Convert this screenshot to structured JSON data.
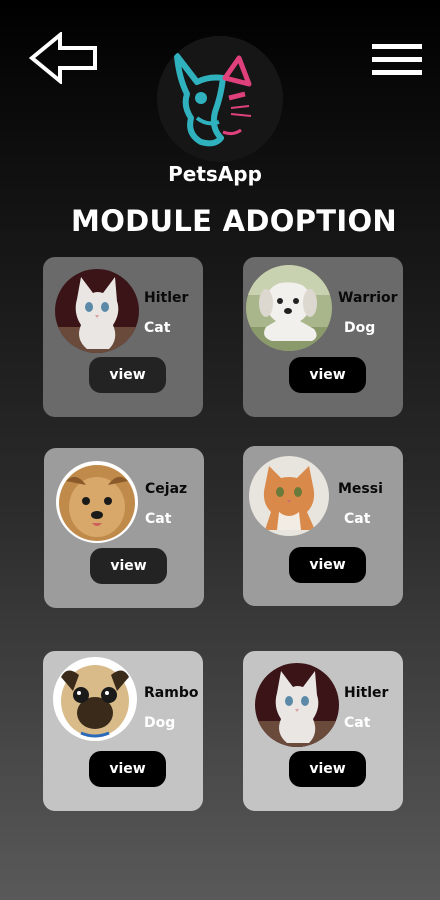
{
  "header": {
    "app_name": "PetsApp",
    "back_icon": "arrow-left-icon",
    "menu_icon": "hamburger-menu-icon",
    "logo": "dog-face-neon-logo"
  },
  "title": "MODULE ADOPTION",
  "colors": {
    "card_row1": "#6a6a6a",
    "card_row2": "#9c9c9c",
    "card_row3": "#c4c4c4",
    "button_dark": "#232323",
    "logo_teal": "#2fb2bd",
    "logo_pink": "#e0417d"
  },
  "pets": [
    {
      "name": "Hitler",
      "type": "Cat",
      "button": "view",
      "photo": "white-kitten-photo"
    },
    {
      "name": "Warrior",
      "type": "Dog",
      "button": "view",
      "photo": "white-puppy-photo"
    },
    {
      "name": "Cejaz",
      "type": "Cat",
      "button": "view",
      "photo": "yorkshire-terrier-photo"
    },
    {
      "name": "Messi",
      "type": "Cat",
      "button": "view",
      "photo": "orange-kitten-photo"
    },
    {
      "name": "Rambo",
      "type": "Dog",
      "button": "view",
      "photo": "pug-photo"
    },
    {
      "name": "Hitler",
      "type": "Cat",
      "button": "view",
      "photo": "white-kitten-photo"
    }
  ]
}
